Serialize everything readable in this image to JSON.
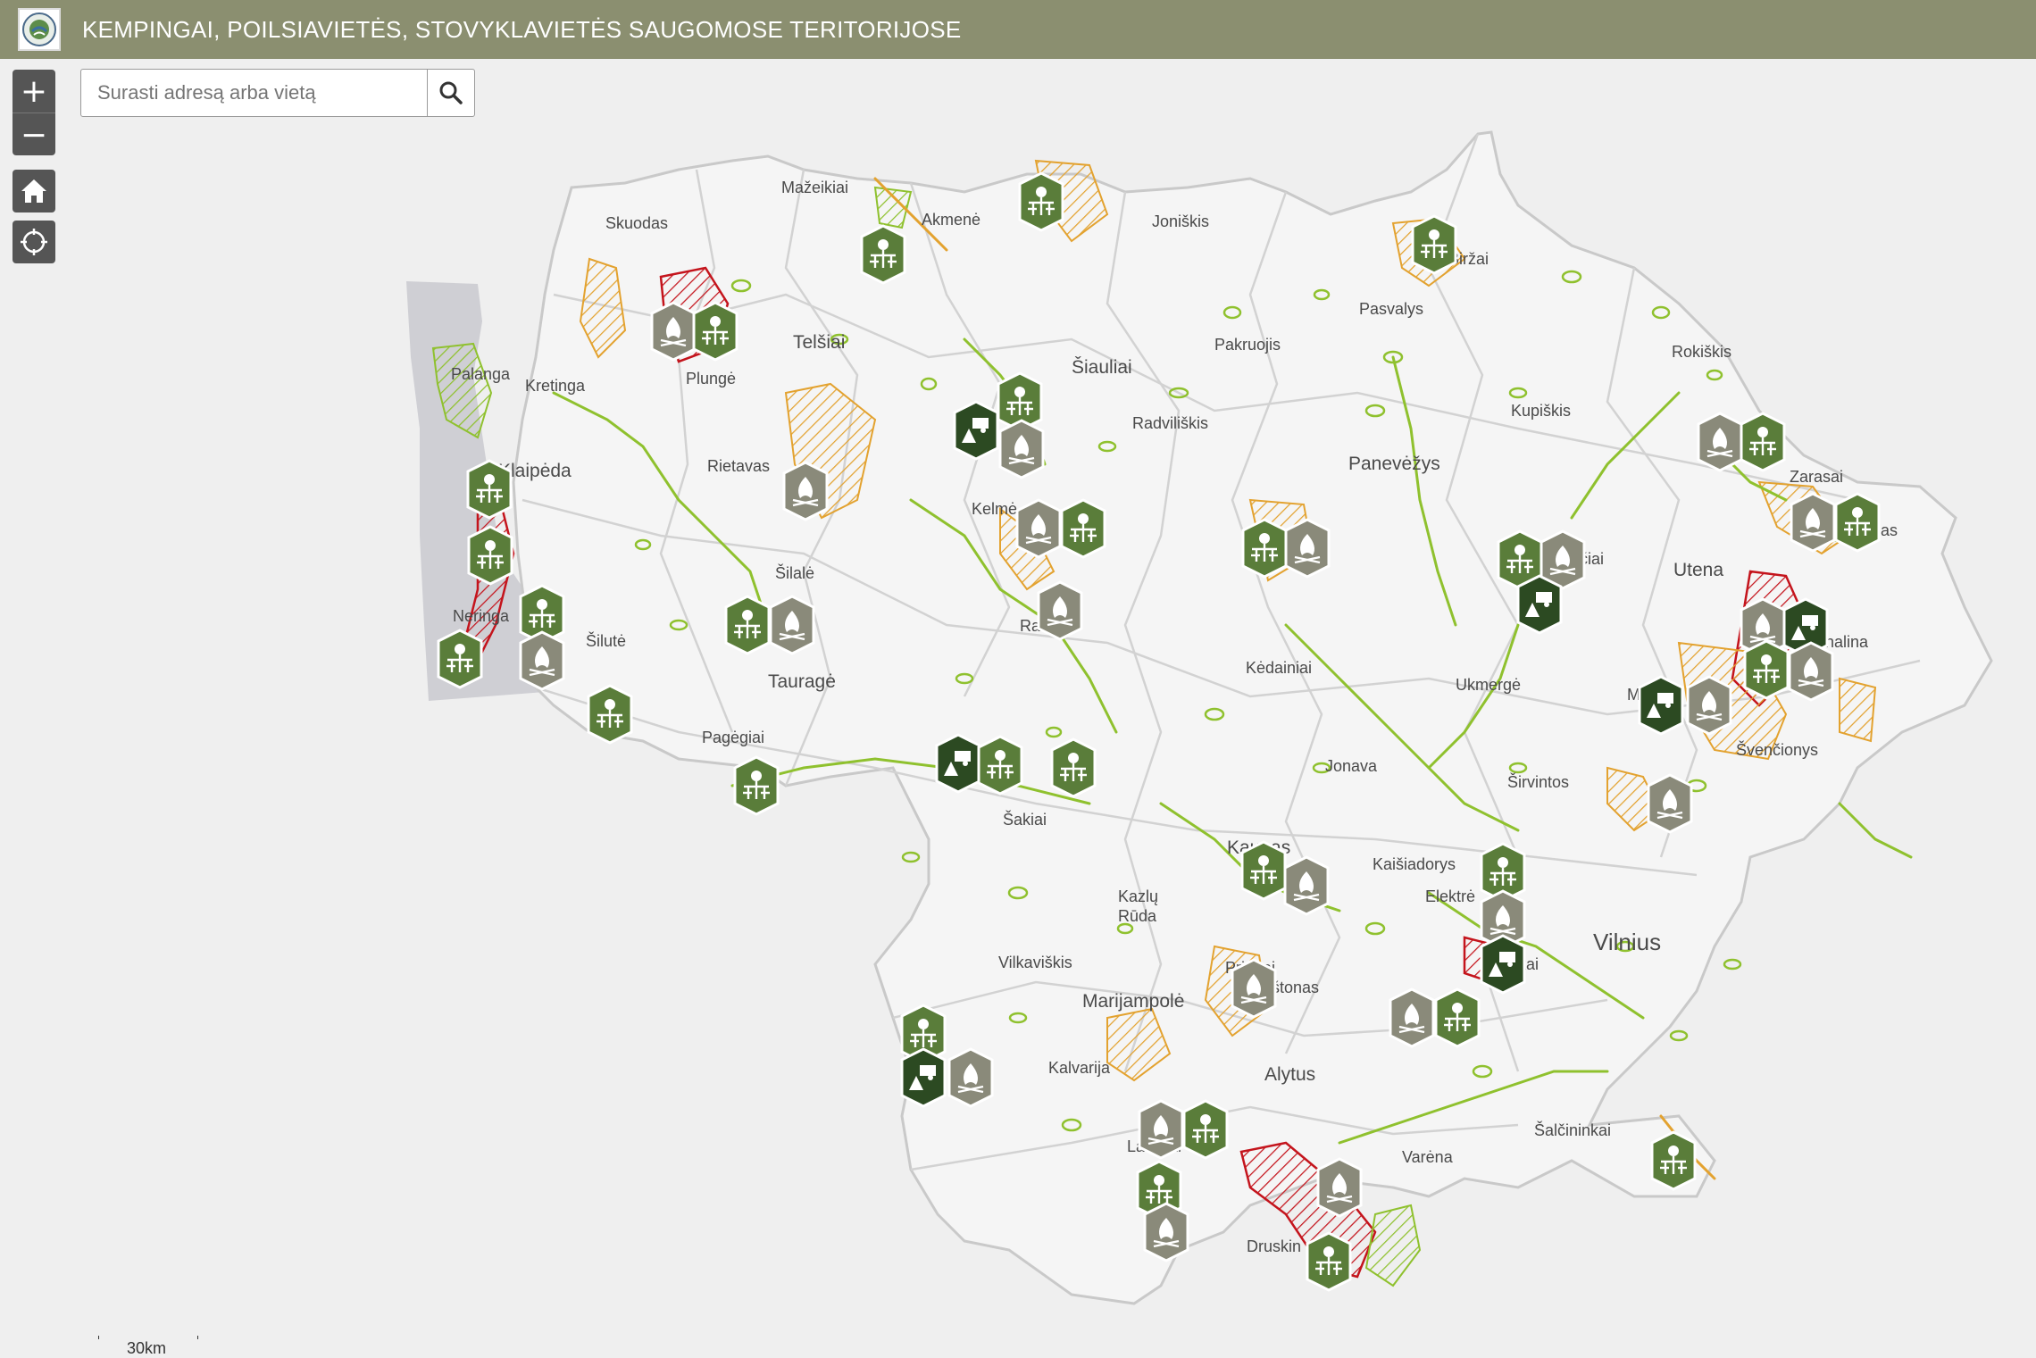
{
  "header": {
    "title": "KEMPINGAI, POILSIAVIETĖS, STOVYKLAVIETĖS SAUGOMOSE TERITORIJOSE",
    "logo": "protected-areas-emblem"
  },
  "controls": {
    "zoom_in": "+",
    "zoom_out": "−",
    "home_icon": "home-icon",
    "locate_icon": "locate-icon"
  },
  "search": {
    "placeholder": "Surasti adresą arba vietą",
    "button_icon": "search-icon"
  },
  "scale": {
    "label": "30km"
  },
  "colors": {
    "header": "#8b8f70",
    "boundary": "#c9c9c9",
    "country_fill": "#f5f5f5",
    "protected_green": "#8fc12e",
    "protected_orange": "#e3a22f",
    "protected_red": "#c4141c",
    "campsite_icon": "#5a7d3a",
    "campfire_icon": "#8a8a7a",
    "camping_icon": "#2c4a22"
  },
  "map": {
    "cities": {
      "mazeikiai": "Mažeikiai",
      "akmene": "Akmenė",
      "joniskis": "Joniškis",
      "birzai": "Biržai",
      "skuodas": "Skuodas",
      "telsiai": "Telšiai",
      "plunge": "Plungė",
      "palanga": "Palanga",
      "kretinga": "Kretinga",
      "klaipeda": "Klaipėda",
      "siauliai": "Šiauliai",
      "pakruojis": "Pakruojis",
      "pasvalys": "Pasvalys",
      "rokiskis": "Rokiškis",
      "radviliskis": "Radviliškis",
      "kupiskis": "Kupiškis",
      "panevezys": "Panevėžys",
      "zarasai": "Zarasai",
      "rietavas": "Rietavas",
      "kelme": "Kelmė",
      "silale": "Šilalė",
      "neringa": "Neringa",
      "silute": "Šilutė",
      "taurage": "Tauragė",
      "raseiniai": "Ra",
      "kedainiai": "Kėdainiai",
      "anyksciai": "ščiai",
      "utena": "Utena",
      "visaginas": "aginas",
      "ignalina": "gnalina",
      "ukmerge": "Ukmergė",
      "moletai": "M",
      "svencionys": "Švenčionys",
      "pagegiai": "Pagėgiai",
      "jonava": "Jonava",
      "sakiai": "Šakiai",
      "sirvintos": "Širvintos",
      "kaunas": "Kaunas",
      "kaisiadorys": "Kaišiadorys",
      "elektrenai": "Elektrė",
      "trakai": "kai",
      "vilnius": "Vilnius",
      "kazlu_ruda_1": "Kazlų",
      "kazlu_ruda_2": "Rūda",
      "vilkaviskis": "Vilkaviškis",
      "marijampole": "Marijampolė",
      "prienai": "Prienai",
      "birstonas": "Birštonas",
      "kalvarija": "Kalvarija",
      "alytus": "Alytus",
      "salcininkai": "Šalčininkai",
      "lazdijai": "Lazdijai",
      "varena": "Varėna",
      "druskininkai": "Druskin"
    }
  }
}
